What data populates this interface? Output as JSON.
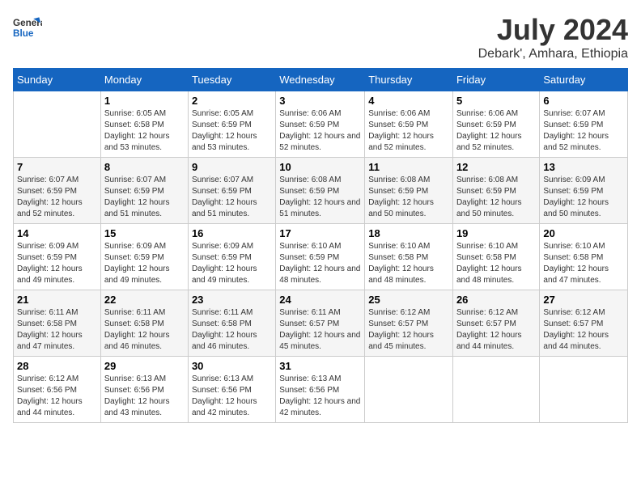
{
  "header": {
    "logo_general": "General",
    "logo_blue": "Blue",
    "month_year": "July 2024",
    "location": "Debark', Amhara, Ethiopia"
  },
  "days_of_week": [
    "Sunday",
    "Monday",
    "Tuesday",
    "Wednesday",
    "Thursday",
    "Friday",
    "Saturday"
  ],
  "weeks": [
    [
      {
        "date": "",
        "sunrise": "",
        "sunset": "",
        "daylight": ""
      },
      {
        "date": "1",
        "sunrise": "Sunrise: 6:05 AM",
        "sunset": "Sunset: 6:58 PM",
        "daylight": "Daylight: 12 hours and 53 minutes."
      },
      {
        "date": "2",
        "sunrise": "Sunrise: 6:05 AM",
        "sunset": "Sunset: 6:59 PM",
        "daylight": "Daylight: 12 hours and 53 minutes."
      },
      {
        "date": "3",
        "sunrise": "Sunrise: 6:06 AM",
        "sunset": "Sunset: 6:59 PM",
        "daylight": "Daylight: 12 hours and 52 minutes."
      },
      {
        "date": "4",
        "sunrise": "Sunrise: 6:06 AM",
        "sunset": "Sunset: 6:59 PM",
        "daylight": "Daylight: 12 hours and 52 minutes."
      },
      {
        "date": "5",
        "sunrise": "Sunrise: 6:06 AM",
        "sunset": "Sunset: 6:59 PM",
        "daylight": "Daylight: 12 hours and 52 minutes."
      },
      {
        "date": "6",
        "sunrise": "Sunrise: 6:07 AM",
        "sunset": "Sunset: 6:59 PM",
        "daylight": "Daylight: 12 hours and 52 minutes."
      }
    ],
    [
      {
        "date": "7",
        "sunrise": "Sunrise: 6:07 AM",
        "sunset": "Sunset: 6:59 PM",
        "daylight": "Daylight: 12 hours and 52 minutes."
      },
      {
        "date": "8",
        "sunrise": "Sunrise: 6:07 AM",
        "sunset": "Sunset: 6:59 PM",
        "daylight": "Daylight: 12 hours and 51 minutes."
      },
      {
        "date": "9",
        "sunrise": "Sunrise: 6:07 AM",
        "sunset": "Sunset: 6:59 PM",
        "daylight": "Daylight: 12 hours and 51 minutes."
      },
      {
        "date": "10",
        "sunrise": "Sunrise: 6:08 AM",
        "sunset": "Sunset: 6:59 PM",
        "daylight": "Daylight: 12 hours and 51 minutes."
      },
      {
        "date": "11",
        "sunrise": "Sunrise: 6:08 AM",
        "sunset": "Sunset: 6:59 PM",
        "daylight": "Daylight: 12 hours and 50 minutes."
      },
      {
        "date": "12",
        "sunrise": "Sunrise: 6:08 AM",
        "sunset": "Sunset: 6:59 PM",
        "daylight": "Daylight: 12 hours and 50 minutes."
      },
      {
        "date": "13",
        "sunrise": "Sunrise: 6:09 AM",
        "sunset": "Sunset: 6:59 PM",
        "daylight": "Daylight: 12 hours and 50 minutes."
      }
    ],
    [
      {
        "date": "14",
        "sunrise": "Sunrise: 6:09 AM",
        "sunset": "Sunset: 6:59 PM",
        "daylight": "Daylight: 12 hours and 49 minutes."
      },
      {
        "date": "15",
        "sunrise": "Sunrise: 6:09 AM",
        "sunset": "Sunset: 6:59 PM",
        "daylight": "Daylight: 12 hours and 49 minutes."
      },
      {
        "date": "16",
        "sunrise": "Sunrise: 6:09 AM",
        "sunset": "Sunset: 6:59 PM",
        "daylight": "Daylight: 12 hours and 49 minutes."
      },
      {
        "date": "17",
        "sunrise": "Sunrise: 6:10 AM",
        "sunset": "Sunset: 6:59 PM",
        "daylight": "Daylight: 12 hours and 48 minutes."
      },
      {
        "date": "18",
        "sunrise": "Sunrise: 6:10 AM",
        "sunset": "Sunset: 6:58 PM",
        "daylight": "Daylight: 12 hours and 48 minutes."
      },
      {
        "date": "19",
        "sunrise": "Sunrise: 6:10 AM",
        "sunset": "Sunset: 6:58 PM",
        "daylight": "Daylight: 12 hours and 48 minutes."
      },
      {
        "date": "20",
        "sunrise": "Sunrise: 6:10 AM",
        "sunset": "Sunset: 6:58 PM",
        "daylight": "Daylight: 12 hours and 47 minutes."
      }
    ],
    [
      {
        "date": "21",
        "sunrise": "Sunrise: 6:11 AM",
        "sunset": "Sunset: 6:58 PM",
        "daylight": "Daylight: 12 hours and 47 minutes."
      },
      {
        "date": "22",
        "sunrise": "Sunrise: 6:11 AM",
        "sunset": "Sunset: 6:58 PM",
        "daylight": "Daylight: 12 hours and 46 minutes."
      },
      {
        "date": "23",
        "sunrise": "Sunrise: 6:11 AM",
        "sunset": "Sunset: 6:58 PM",
        "daylight": "Daylight: 12 hours and 46 minutes."
      },
      {
        "date": "24",
        "sunrise": "Sunrise: 6:11 AM",
        "sunset": "Sunset: 6:57 PM",
        "daylight": "Daylight: 12 hours and 45 minutes."
      },
      {
        "date": "25",
        "sunrise": "Sunrise: 6:12 AM",
        "sunset": "Sunset: 6:57 PM",
        "daylight": "Daylight: 12 hours and 45 minutes."
      },
      {
        "date": "26",
        "sunrise": "Sunrise: 6:12 AM",
        "sunset": "Sunset: 6:57 PM",
        "daylight": "Daylight: 12 hours and 44 minutes."
      },
      {
        "date": "27",
        "sunrise": "Sunrise: 6:12 AM",
        "sunset": "Sunset: 6:57 PM",
        "daylight": "Daylight: 12 hours and 44 minutes."
      }
    ],
    [
      {
        "date": "28",
        "sunrise": "Sunrise: 6:12 AM",
        "sunset": "Sunset: 6:56 PM",
        "daylight": "Daylight: 12 hours and 44 minutes."
      },
      {
        "date": "29",
        "sunrise": "Sunrise: 6:13 AM",
        "sunset": "Sunset: 6:56 PM",
        "daylight": "Daylight: 12 hours and 43 minutes."
      },
      {
        "date": "30",
        "sunrise": "Sunrise: 6:13 AM",
        "sunset": "Sunset: 6:56 PM",
        "daylight": "Daylight: 12 hours and 42 minutes."
      },
      {
        "date": "31",
        "sunrise": "Sunrise: 6:13 AM",
        "sunset": "Sunset: 6:56 PM",
        "daylight": "Daylight: 12 hours and 42 minutes."
      },
      {
        "date": "",
        "sunrise": "",
        "sunset": "",
        "daylight": ""
      },
      {
        "date": "",
        "sunrise": "",
        "sunset": "",
        "daylight": ""
      },
      {
        "date": "",
        "sunrise": "",
        "sunset": "",
        "daylight": ""
      }
    ]
  ]
}
